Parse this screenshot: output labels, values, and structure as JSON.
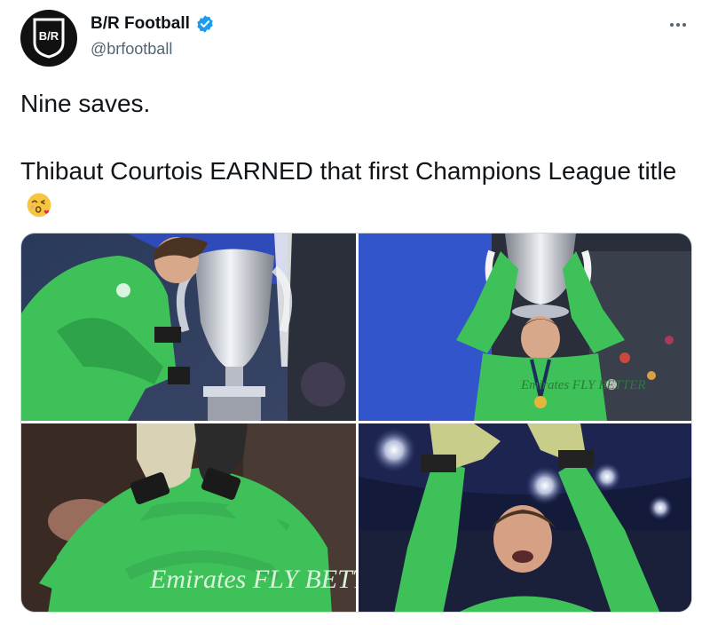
{
  "account": {
    "display_name": "B/R Football",
    "handle": "@brfootball",
    "avatar_text": "B/R",
    "verified": true
  },
  "tweet": {
    "line1": "Nine saves.",
    "line2": "Thibaut Courtois EARNED that first Champions League title",
    "emoji": "face-blowing-a-kiss"
  },
  "media": {
    "count": 4,
    "photos": [
      {
        "subject": "goalkeeper-kissing-trophy",
        "shirt_text": ""
      },
      {
        "subject": "goalkeeper-lifting-trophy-overhead",
        "shirt_text": "Emirates FLY BETTER"
      },
      {
        "subject": "goalkeeper-hands-over-face",
        "shirt_text": "Emirates FLY BETTER"
      },
      {
        "subject": "goalkeeper-celebrating-stadium-lights",
        "shirt_text": ""
      }
    ]
  },
  "colors": {
    "text": "#0f1419",
    "secondary": "#536471",
    "verified": "#1d9bf0",
    "kit_green": "#3fc15a",
    "border": "#cfd9de"
  }
}
